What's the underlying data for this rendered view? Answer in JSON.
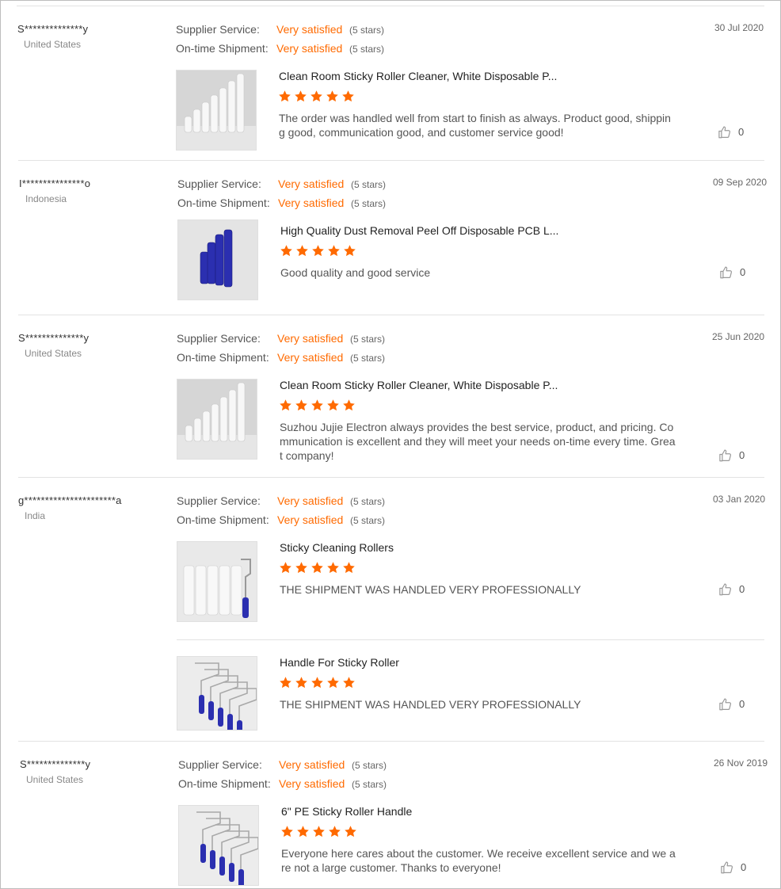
{
  "labels": {
    "supplier_service": "Supplier Service:",
    "ontime_shipment": "On-time Shipment:",
    "star_icon": "star-icon",
    "like_icon": "thumbs-up-icon"
  },
  "colors": {
    "accent": "#ff6a00",
    "star": "#ff6a00"
  },
  "reviews": [
    {
      "user": "S**************y",
      "country": "United States",
      "supplier_value": "Very satisfied",
      "supplier_stars": "(5 stars)",
      "shipment_value": "Very satisfied",
      "shipment_stars": "(5 stars)",
      "date": "30 Jul 2020",
      "products": [
        {
          "image": "white-rollers",
          "title": "Clean Room Sticky Roller Cleaner, White Disposable P...",
          "rating": 5,
          "comment": "The order was handled well from start to finish as always.  Product good, shipping good, communication good, and customer service good!",
          "likes": "0"
        }
      ]
    },
    {
      "user": "I***************o",
      "country": "Indonesia",
      "supplier_value": "Very satisfied",
      "supplier_stars": "(5 stars)",
      "shipment_value": "Very satisfied",
      "shipment_stars": "(5 stars)",
      "date": "09 Sep 2020",
      "products": [
        {
          "image": "blue-rollers",
          "title": "High Quality Dust Removal Peel Off Disposable PCB L...",
          "rating": 5,
          "comment": "Good quality and good service",
          "likes": "0"
        }
      ]
    },
    {
      "user": "S**************y",
      "country": "United States",
      "supplier_value": "Very satisfied",
      "supplier_stars": "(5 stars)",
      "shipment_value": "Very satisfied",
      "shipment_stars": "(5 stars)",
      "date": "25 Jun 2020",
      "products": [
        {
          "image": "white-rollers",
          "title": "Clean Room Sticky Roller Cleaner, White Disposable P...",
          "rating": 5,
          "comment": "Suzhou Jujie Electron always provides the best service, product, and pricing. Communication is excellent and they will meet your needs on-time every time.  Great company!",
          "likes": "0"
        }
      ]
    },
    {
      "user": "g**********************a",
      "country": "India",
      "supplier_value": "Very satisfied",
      "supplier_stars": "(5 stars)",
      "shipment_value": "Very satisfied",
      "shipment_stars": "(5 stars)",
      "date": "03 Jan 2020",
      "products": [
        {
          "image": "cleaning-rollers",
          "title": "Sticky Cleaning Rollers",
          "rating": 5,
          "comment": "THE SHIPMENT WAS HANDLED VERY PROFESSIONALLY",
          "likes": "0"
        },
        {
          "image": "roller-handles",
          "title": "Handle For Sticky Roller",
          "rating": 5,
          "comment": "THE SHIPMENT WAS HANDLED VERY PROFESSIONALLY",
          "likes": "0"
        }
      ]
    },
    {
      "user": "S**************y",
      "country": "United States",
      "supplier_value": "Very satisfied",
      "supplier_stars": "(5 stars)",
      "shipment_value": "Very satisfied",
      "shipment_stars": "(5 stars)",
      "date": "26 Nov 2019",
      "products": [
        {
          "image": "roller-handles",
          "title": "6\" PE Sticky Roller Handle",
          "rating": 5,
          "comment": "Everyone here cares about the customer.  We receive excellent service and we are not a large customer.  Thanks to everyone!",
          "likes": "0"
        }
      ]
    }
  ]
}
